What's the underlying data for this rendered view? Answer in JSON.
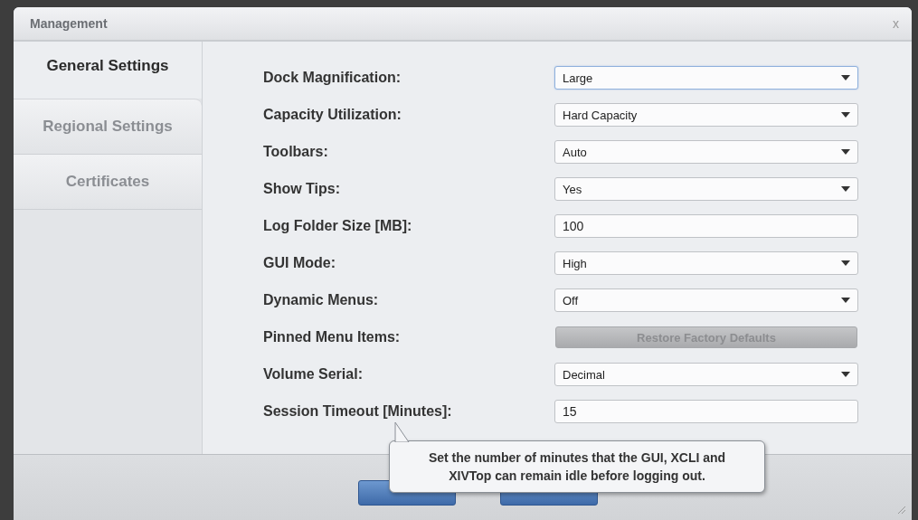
{
  "window": {
    "title": "Management",
    "close": "x"
  },
  "tabs": [
    {
      "label": "General Settings",
      "selected": true
    },
    {
      "label": "Regional Settings",
      "selected": false
    },
    {
      "label": "Certificates",
      "selected": false
    }
  ],
  "settings": [
    {
      "label": "Dock Magnification:",
      "kind": "select",
      "value": "Large",
      "focused": true
    },
    {
      "label": "Capacity Utilization:",
      "kind": "select",
      "value": "Hard Capacity",
      "focused": false
    },
    {
      "label": "Toolbars:",
      "kind": "select",
      "value": "Auto",
      "focused": false
    },
    {
      "label": "Show Tips:",
      "kind": "select",
      "value": "Yes",
      "focused": false
    },
    {
      "label": "Log Folder Size [MB]:",
      "kind": "input",
      "value": "100",
      "focused": false
    },
    {
      "label": "GUI Mode:",
      "kind": "select",
      "value": "High",
      "focused": false
    },
    {
      "label": "Dynamic Menus:",
      "kind": "select",
      "value": "Off",
      "focused": false
    },
    {
      "label": "Pinned Menu Items:",
      "kind": "button",
      "value": "Restore Factory Defaults",
      "disabled": true
    },
    {
      "label": "Volume Serial:",
      "kind": "select",
      "value": "Decimal",
      "focused": false
    },
    {
      "label": "Session Timeout [Minutes]:",
      "kind": "input",
      "value": "15",
      "focused": false
    }
  ],
  "tooltip": "Set the number of minutes that the GUI, XCLI and XIVTop can remain idle before logging out."
}
